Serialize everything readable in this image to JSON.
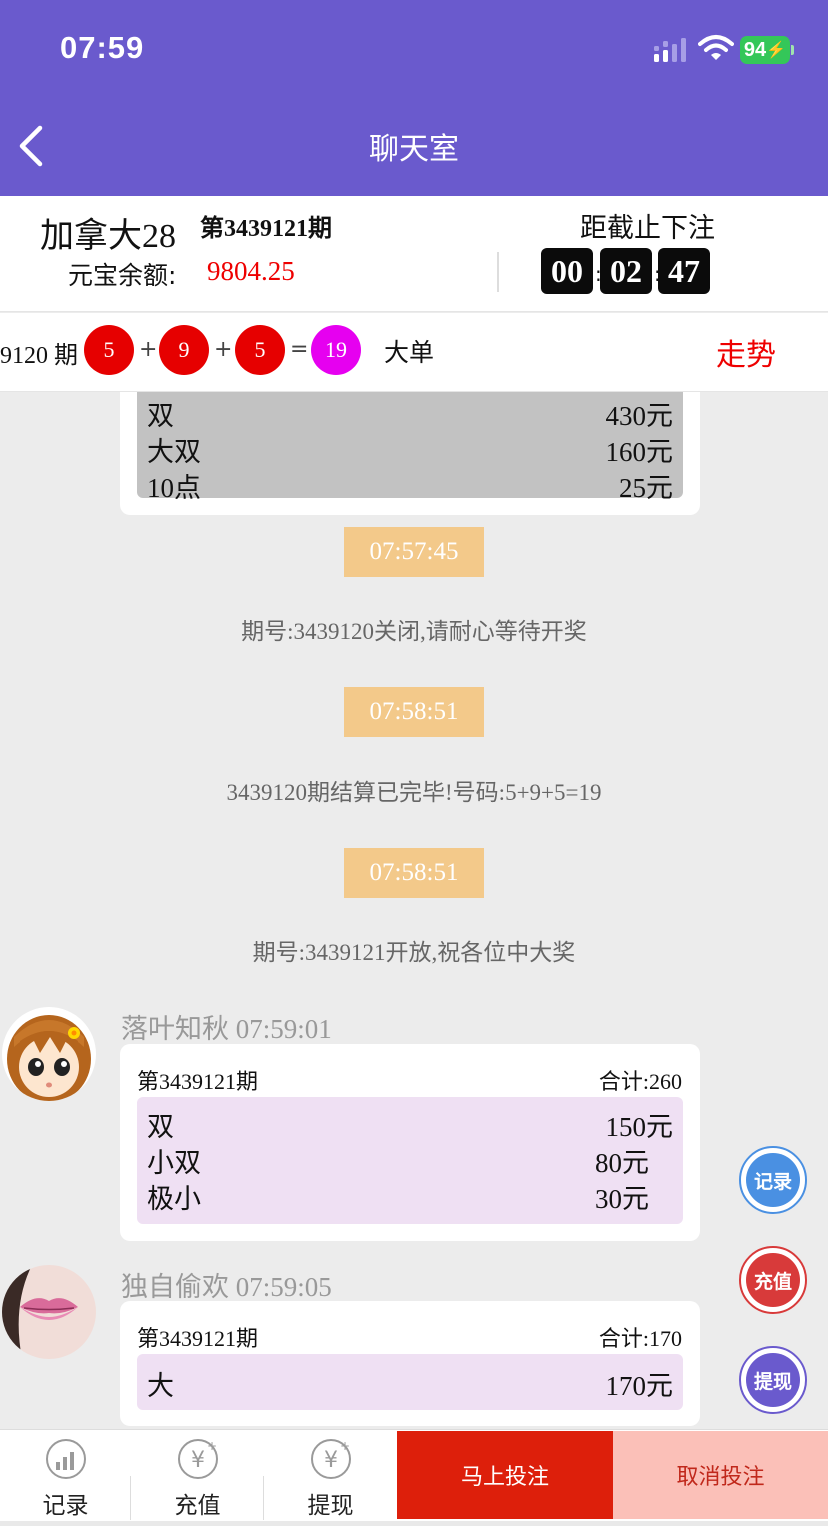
{
  "status_bar": {
    "time": "07:59",
    "battery": "94"
  },
  "header": {
    "title": "聊天室"
  },
  "info": {
    "game_name": "加拿大28",
    "period_label": "第3439121期",
    "balance_label": "元宝余额:",
    "balance_value": "9804.25",
    "deadline_label": "距截止下注",
    "countdown": [
      "00",
      "02",
      "47"
    ]
  },
  "last_result": {
    "period_label": "9120 期",
    "balls": [
      "5",
      "9",
      "5"
    ],
    "sum": "19",
    "plus": "+",
    "equals": "=",
    "result_type": "大单",
    "trend_label": "走势"
  },
  "chat": {
    "top_card": {
      "rows": [
        {
          "name": "双",
          "amount": "430元"
        },
        {
          "name": "大双",
          "amount": "160元"
        },
        {
          "name": "10点",
          "amount": "25元"
        }
      ]
    },
    "system": [
      {
        "time": "07:57:45",
        "message": "期号:3439120关闭,请耐心等待开奖"
      },
      {
        "time": "07:58:51",
        "message": "3439120期结算已完毕!号码:5+9+5=19"
      },
      {
        "time": "07:58:51",
        "message": "期号:3439121开放,祝各位中大奖"
      }
    ],
    "messages": [
      {
        "user": "落叶知秋",
        "time": "07:59:01",
        "period": "第3439121期",
        "total": "合计:260",
        "rows": [
          {
            "name": "双",
            "amount": "150元"
          },
          {
            "name": "小双",
            "amount": "80元"
          },
          {
            "name": "极小",
            "amount": "30元"
          }
        ]
      },
      {
        "user": "独自偷欢",
        "time": "07:59:05",
        "period": "第3439121期",
        "total": "合计:170",
        "rows": [
          {
            "name": "大",
            "amount": "170元"
          }
        ]
      }
    ]
  },
  "float_buttons": {
    "record": "记录",
    "recharge": "充值",
    "withdraw": "提现"
  },
  "bottom_bar": {
    "record": "记录",
    "recharge": "充值",
    "withdraw": "提现",
    "bet_now": "马上投注",
    "cancel_bet": "取消投注"
  },
  "colors": {
    "header": "#6a5acd",
    "red_ball": "#e60000",
    "sum_ball": "#e600f0",
    "time_chip": "#f3c98a",
    "bet_button": "#dd1f0b",
    "cancel_button": "#fbc0b8"
  }
}
